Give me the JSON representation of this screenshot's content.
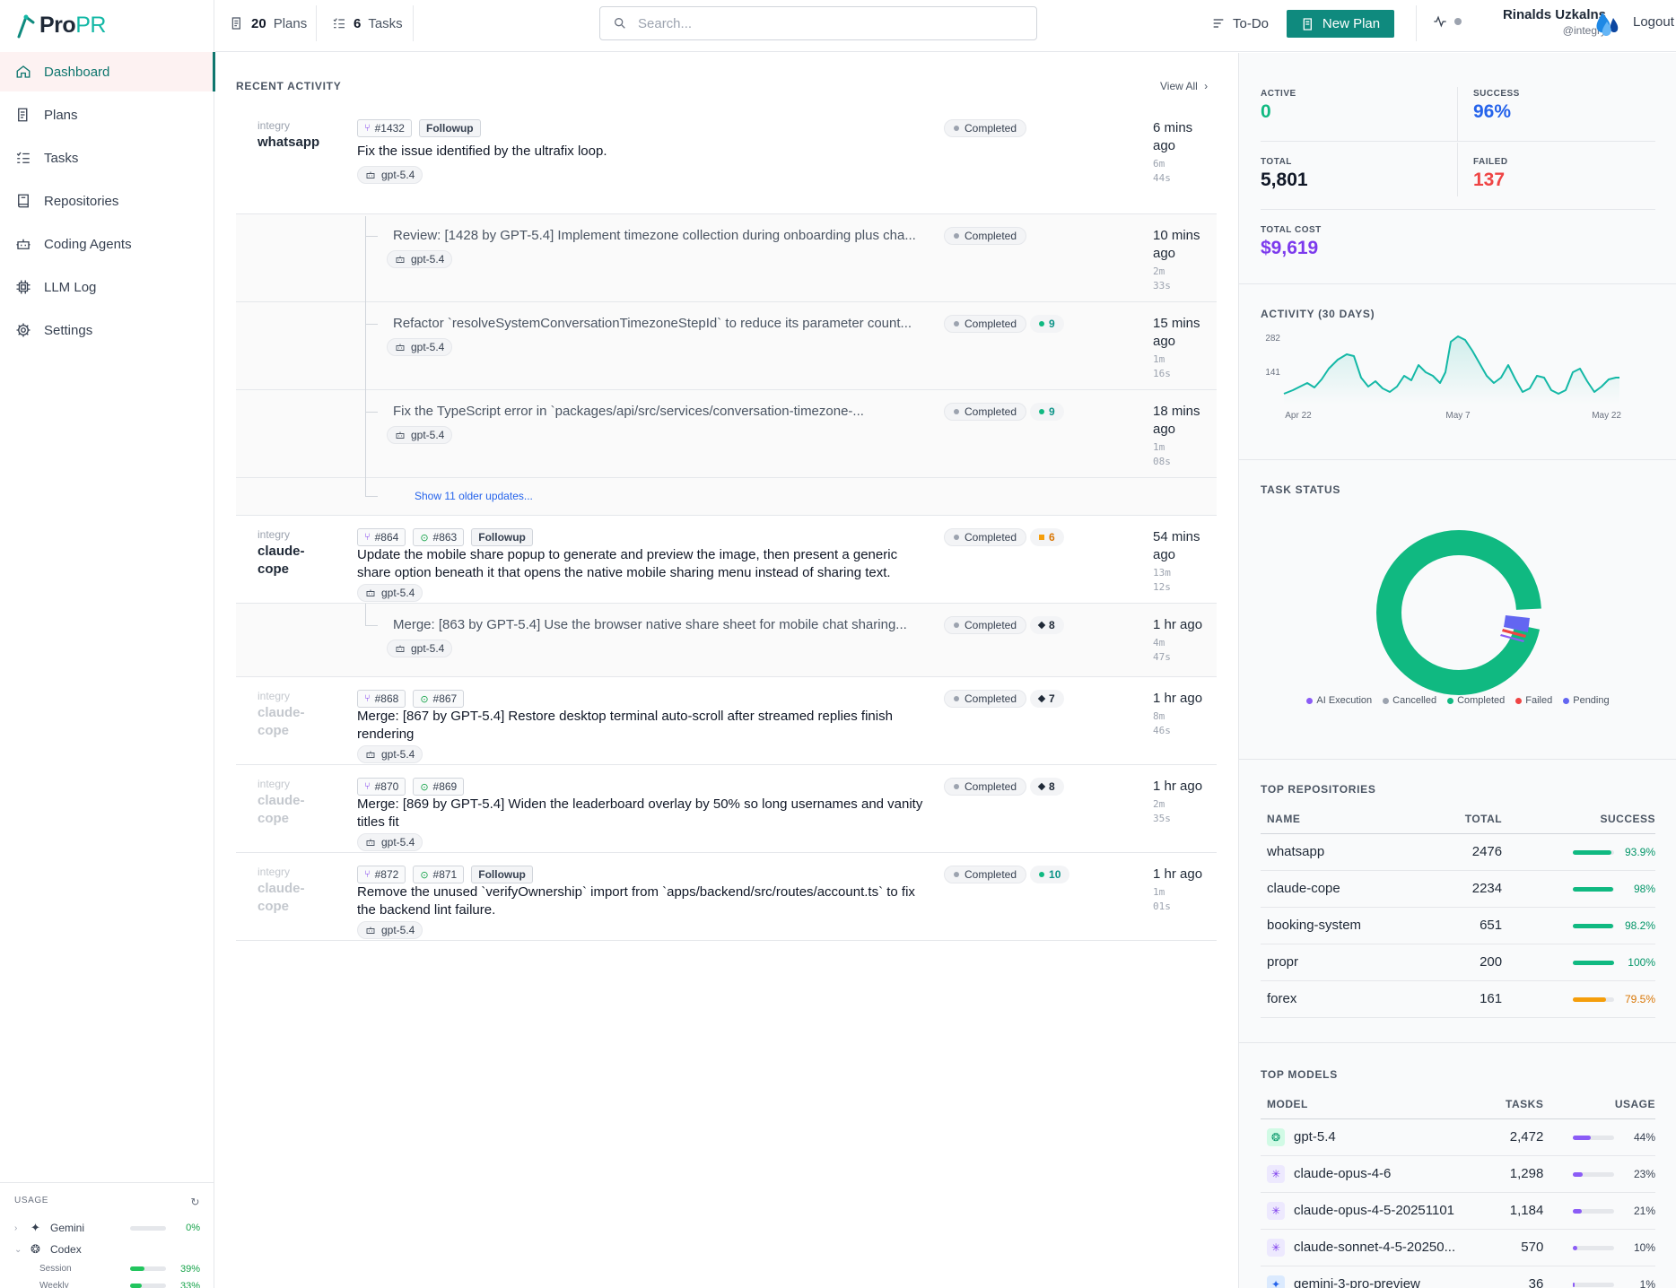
{
  "app": {
    "logo_pro": "Pro",
    "logo_pr": "PR"
  },
  "sidebar": {
    "items": [
      {
        "label": "Dashboard",
        "icon": "home-icon"
      },
      {
        "label": "Plans",
        "icon": "plans-icon"
      },
      {
        "label": "Tasks",
        "icon": "tasks-icon"
      },
      {
        "label": "Repositories",
        "icon": "repository-icon"
      },
      {
        "label": "Coding Agents",
        "icon": "robot-icon"
      },
      {
        "label": "LLM Log",
        "icon": "chip-icon"
      },
      {
        "label": "Settings",
        "icon": "gear-icon"
      }
    ]
  },
  "usage": {
    "title": "USAGE",
    "rows": [
      {
        "name": "Gemini",
        "pct": "0%",
        "value": 0
      },
      {
        "name": "Codex",
        "pct": "",
        "value": null
      }
    ],
    "sub": [
      {
        "name": "Session",
        "pct": "39%",
        "value": 39
      },
      {
        "name": "Weekly",
        "pct": "33%",
        "value": 33
      }
    ]
  },
  "topbar": {
    "plans_count": "20",
    "plans_label": "Plans",
    "tasks_count": "6",
    "tasks_label": "Tasks",
    "search_placeholder": "Search...",
    "todo_label": "To-Do",
    "new_plan_label": "New Plan",
    "user_name": "Rinalds Uzkalns",
    "user_handle": "@integry",
    "logout_label": "Logout"
  },
  "activity": {
    "title": "RECENT ACTIVITY",
    "view_all": "View All",
    "show_older": "Show 11 older updates...",
    "rows": [
      {
        "org": "integry",
        "repo": "whatsapp",
        "pr": "#1432",
        "issue": "",
        "tag": "Followup",
        "title": "Fix the issue identified by the ultrafix loop.",
        "model": "gpt-5.4",
        "status": "Completed",
        "score": "",
        "score_type": "",
        "time": "6 mins ago",
        "dur1": "6m",
        "dur2": "44s"
      },
      {
        "title": "Review: [1428 by GPT-5.4] Implement timezone collection during onboarding plus cha...",
        "model": "gpt-5.4",
        "status": "Completed",
        "score": "",
        "score_type": "",
        "time": "10 mins ago",
        "dur1": "2m",
        "dur2": "33s"
      },
      {
        "title": "Refactor `resolveSystemConversationTimezoneStepId` to reduce its parameter count...",
        "model": "gpt-5.4",
        "status": "Completed",
        "score": "9",
        "score_type": "g",
        "time": "15 mins ago",
        "dur1": "1m",
        "dur2": "16s"
      },
      {
        "title": "Fix the TypeScript error in `packages/api/src/services/conversation-timezone-...",
        "model": "gpt-5.4",
        "status": "Completed",
        "score": "9",
        "score_type": "g",
        "time": "18 mins ago",
        "dur1": "1m",
        "dur2": "08s"
      },
      {
        "org": "integry",
        "repo": "claude-cope",
        "pr": "#864",
        "issue": "#863",
        "tag": "Followup",
        "title": "Update the mobile share popup to generate and preview the image, then present a generic share option beneath it that opens the native mobile sharing menu instead of sharing text.",
        "model": "gpt-5.4",
        "status": "Completed",
        "score": "6",
        "score_type": "o",
        "time": "54 mins ago",
        "dur1": "13m",
        "dur2": "12s"
      },
      {
        "title": "Merge: [863 by GPT-5.4] Use the browser native share sheet for mobile chat sharing...",
        "model": "gpt-5.4",
        "status": "Completed",
        "score": "8",
        "score_type": "k",
        "time": "1 hr ago",
        "dur1": "4m",
        "dur2": "47s"
      },
      {
        "org": "integry",
        "repo": "claude-cope",
        "pr": "#868",
        "issue": "#867",
        "tag": "",
        "title": "Merge: [867 by GPT-5.4] Restore desktop terminal auto-scroll after streamed replies finish rendering",
        "model": "gpt-5.4",
        "status": "Completed",
        "score": "7",
        "score_type": "k",
        "time": "1 hr ago",
        "dur1": "8m",
        "dur2": "46s"
      },
      {
        "org": "integry",
        "repo": "claude-cope",
        "pr": "#870",
        "issue": "#869",
        "tag": "",
        "title": "Merge: [869 by GPT-5.4] Widen the leaderboard overlay by 50% so long usernames and vanity titles fit",
        "model": "gpt-5.4",
        "status": "Completed",
        "score": "8",
        "score_type": "k",
        "time": "1 hr ago",
        "dur1": "2m",
        "dur2": "35s"
      },
      {
        "org": "integry",
        "repo": "claude-cope",
        "pr": "#872",
        "issue": "#871",
        "tag": "Followup",
        "title": "Remove the unused `verifyOwnership` import from `apps/backend/src/routes/account.ts` to fix the backend lint failure.",
        "model": "gpt-5.4",
        "status": "Completed",
        "score": "10",
        "score_type": "g",
        "time": "1 hr ago",
        "dur1": "1m",
        "dur2": "01s"
      }
    ]
  },
  "stats": {
    "active_label": "ACTIVE",
    "active": "0",
    "success_label": "SUCCESS",
    "success": "96%",
    "total_label": "TOTAL",
    "total": "5,801",
    "failed_label": "FAILED",
    "failed": "137",
    "cost_label": "TOTAL COST",
    "cost": "$9,619"
  },
  "activity_chart": {
    "title": "ACTIVITY (30 DAYS)",
    "y_ticks": [
      "282",
      "141"
    ],
    "x_ticks": [
      "Apr 22",
      "May 7",
      "May 22"
    ],
    "color": "#14b8a6"
  },
  "task_status": {
    "title": "TASK STATUS",
    "legend": [
      {
        "name": "AI Execution",
        "color": "#8b5cf6"
      },
      {
        "name": "Cancelled",
        "color": "#9ca3af"
      },
      {
        "name": "Completed",
        "color": "#10b981"
      },
      {
        "name": "Failed",
        "color": "#ef4444"
      },
      {
        "name": "Pending",
        "color": "#6366f1"
      }
    ]
  },
  "top_repos": {
    "title": "TOP REPOSITORIES",
    "headers": [
      "NAME",
      "TOTAL",
      "SUCCESS"
    ],
    "rows": [
      {
        "name": "whatsapp",
        "total": "2476",
        "success": "93.9%",
        "value": 93.9,
        "color": "#10b981"
      },
      {
        "name": "claude-cope",
        "total": "2234",
        "success": "98%",
        "value": 98,
        "color": "#10b981"
      },
      {
        "name": "booking-system",
        "total": "651",
        "success": "98.2%",
        "value": 98.2,
        "color": "#10b981"
      },
      {
        "name": "propr",
        "total": "200",
        "success": "100%",
        "value": 100,
        "color": "#10b981"
      },
      {
        "name": "forex",
        "total": "161",
        "success": "79.5%",
        "value": 79.5,
        "color": "#f59e0b"
      }
    ]
  },
  "top_models": {
    "title": "TOP MODELS",
    "headers": [
      "MODEL",
      "TASKS",
      "USAGE"
    ],
    "rows": [
      {
        "name": "gpt-5.4",
        "tasks": "2,472",
        "usage": "44%",
        "value": 44,
        "icon": "openai-icon"
      },
      {
        "name": "claude-opus-4-6",
        "tasks": "1,298",
        "usage": "23%",
        "value": 23,
        "icon": "anthropic-icon"
      },
      {
        "name": "claude-opus-4-5-20251101",
        "tasks": "1,184",
        "usage": "21%",
        "value": 21,
        "icon": "anthropic-icon"
      },
      {
        "name": "claude-sonnet-4-5-20250...",
        "tasks": "570",
        "usage": "10%",
        "value": 10,
        "icon": "anthropic-icon"
      },
      {
        "name": "gemini-3-pro-preview",
        "tasks": "36",
        "usage": "1%",
        "value": 1,
        "icon": "gemini-icon"
      }
    ]
  }
}
